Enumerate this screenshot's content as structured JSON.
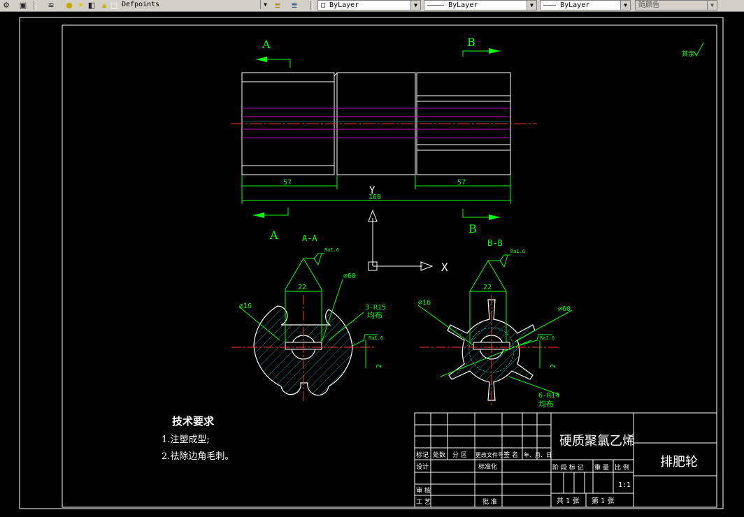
{
  "toolbar": {
    "layer_name": "Defpoints",
    "color": "ByLayer",
    "linetype": "ByLayer",
    "lineweight": "ByLayer",
    "plotstyle": "随颜色"
  },
  "drawing": {
    "section_a_top": "A",
    "section_b_top": "B",
    "section_a_bottom": "A",
    "section_b_bottom": "B",
    "roughness_corner": "其余",
    "dim_left": "57",
    "dim_right": "57",
    "dim_total": "160",
    "ucs_x": "X",
    "ucs_y": "Y",
    "view_aa": {
      "title": "A-A",
      "rough": "Ra1.6",
      "width": "22",
      "dia_outer": "⌀60",
      "dia_inner": "⌀16",
      "radius_note": "3-R15",
      "radius_note2": "均布",
      "rough2": "Ra1.6",
      "depth": "2"
    },
    "view_bb": {
      "title": "B-B",
      "rough": "Ra1.6",
      "width": "22",
      "dia_inner": "⌀16",
      "dia_outer": "⌀60",
      "rough2": "Ra1.6",
      "depth": "2",
      "radius_note": "6-R14",
      "radius_note2": "均布"
    },
    "tech_title": "技术要求",
    "tech_items": [
      "1.注塑成型;",
      "2.祛除边角毛刺。"
    ]
  },
  "title_block": {
    "material": "硬质聚氯乙烯",
    "part_name": "排肥轮",
    "h_mark": "标记",
    "h_count": "处数",
    "h_zone": "分 区",
    "h_docno": "更改文件号",
    "h_sign": "签 名",
    "h_date": "年、月、日",
    "design": "设计",
    "standardize": "标准化",
    "stage_mark": "阶 段 标 记",
    "weight": "重 量",
    "scale_label": "比 例",
    "scale": "1:1",
    "review": "审 核",
    "process": "工 艺",
    "approve": "批 准",
    "total_sheets": "共 1 张",
    "sheet_no": "第 1 张"
  }
}
